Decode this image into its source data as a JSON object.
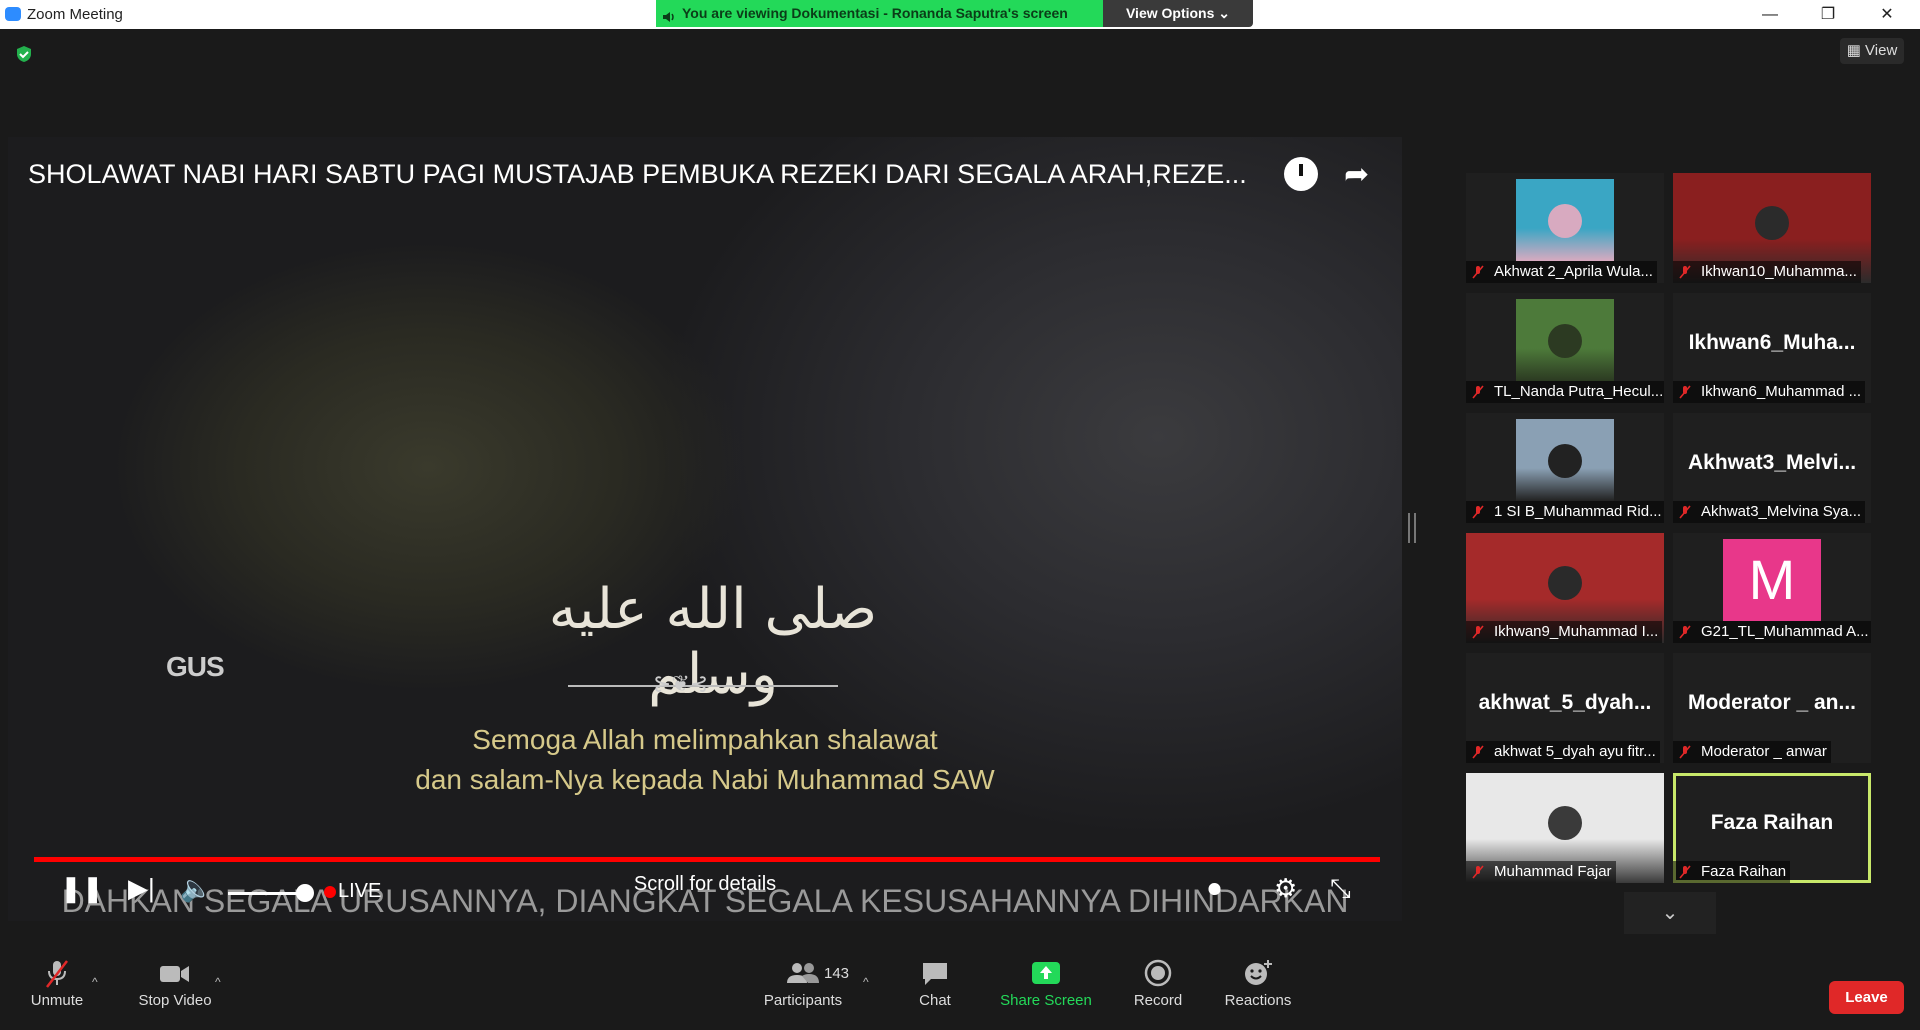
{
  "window": {
    "title": "Zoom Meeting",
    "minimize": "—",
    "restore": "❐",
    "close": "✕"
  },
  "banner": {
    "text": "You are viewing Dokumentasi - Ronanda Saputra's screen",
    "view_options": "View Options ⌄"
  },
  "view_button": {
    "label": "View"
  },
  "video": {
    "title": "SHOLAWAT NABI HARI SABTU PAGI MUSTAJAB PEMBUKA REZEKI DARI SEGALA ARAH,REZE...",
    "arabic": "صلى الله عليه وسلم",
    "ornament": "⊱❦⊰",
    "logo": "GUS",
    "subtitle_line1": "Semoga Allah melimpahkan shalawat",
    "subtitle_line2": "dan salam-Nya kepada Nabi Muhammad SAW",
    "live_label": "LIVE",
    "scroll_label": "Scroll for details",
    "ticker": "DAHKAN SEGALA URUSANNYA, DIANGKAT SEGALA KESUSAHANNYA DIHINDARKAN",
    "progress_fraction": 1.0
  },
  "participants_panel": {
    "tiles": [
      {
        "name": "Akhwat 2_Aprila Wula...",
        "big": ""
      },
      {
        "name": "Ikhwan10_Muhamma...",
        "big": ""
      },
      {
        "name": "TL_Nanda Putra_Hecul...",
        "big": ""
      },
      {
        "name": "Ikhwan6_Muhammad ...",
        "big": "Ikhwan6_Muha..."
      },
      {
        "name": "1 SI B_Muhammad Rid...",
        "big": ""
      },
      {
        "name": "Akhwat3_Melvina Sya...",
        "big": "Akhwat3_Melvi..."
      },
      {
        "name": "Ikhwan9_Muhammad I...",
        "big": ""
      },
      {
        "name": "G21_TL_Muhammad A...",
        "big": "M"
      },
      {
        "name": "akhwat 5_dyah ayu fitr...",
        "big": "akhwat_5_dyah..."
      },
      {
        "name": "Moderator _ anwar",
        "big": "Moderator _ an..."
      },
      {
        "name": "Muhammad Fajar",
        "big": ""
      },
      {
        "name": "Faza Raihan",
        "big": "Faza Raihan"
      }
    ],
    "more": "⌄"
  },
  "toolbar": {
    "unmute": "Unmute",
    "stop_video": "Stop Video",
    "participants": "Participants",
    "participants_count": "143",
    "chat": "Chat",
    "share_screen": "Share Screen",
    "record": "Record",
    "reactions": "Reactions",
    "leave": "Leave"
  },
  "colors": {
    "share_green": "#23d959",
    "leave_red": "#e02828",
    "active_speaker": "#c8e86a",
    "avatar_m": "#e8378a"
  }
}
